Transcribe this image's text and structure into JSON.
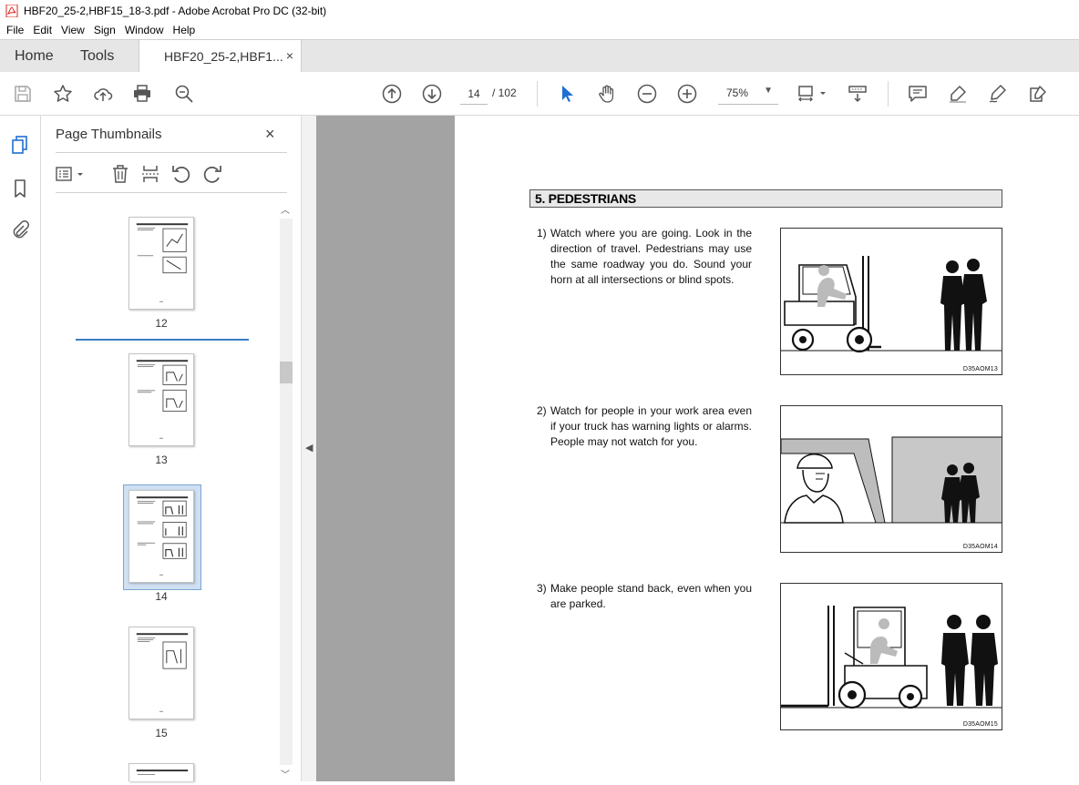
{
  "window": {
    "title": "HBF20_25-2,HBF15_18-3.pdf - Adobe Acrobat Pro DC (32-bit)"
  },
  "menu": [
    "File",
    "Edit",
    "View",
    "Sign",
    "Window",
    "Help"
  ],
  "tabs": {
    "home": "Home",
    "tools": "Tools",
    "document": "HBF20_25-2,HBF1...",
    "close": "×"
  },
  "toolbar": {
    "current_page": "14",
    "total_pages": "/ 102",
    "zoom": "75%",
    "icons": [
      "save-icon",
      "bookmark-star-icon",
      "upload-icon",
      "print-icon",
      "zoom-search-icon",
      "page-up-icon",
      "page-down-icon",
      "select-cursor-icon",
      "hand-icon",
      "zoom-out-icon",
      "zoom-in-icon",
      "page-fit-icon",
      "scroll-mode-icon",
      "comment-icon",
      "highlight-icon",
      "sign-icon",
      "fill-sign-icon"
    ]
  },
  "thumbnails_panel": {
    "title": "Page Thumbnails",
    "close": "×",
    "pages": [
      {
        "label": "12",
        "selected": false
      },
      {
        "label": "13",
        "selected": false
      },
      {
        "label": "14",
        "selected": true
      },
      {
        "label": "15",
        "selected": false
      }
    ]
  },
  "document": {
    "section_title": "5. PEDESTRIANS",
    "items": [
      {
        "num": "1)",
        "text": "Watch where you are going.  Look in the direction of travel.  Pedestrians may use the same roadway you do.  Sound your horn at all intersections or blind spots.",
        "caption": "D35AOM13"
      },
      {
        "num": "2)",
        "text": "Watch for people in your work area even if your truck has warning lights or alarms. People may not watch for you.",
        "caption": "D35AOM14"
      },
      {
        "num": "3)",
        "text": "Make people stand back, even when you are parked.",
        "caption": "D35AOM15"
      }
    ]
  },
  "colors": {
    "active_thumb": "#cfe0f2",
    "accent": "#3b7dc4",
    "prev_page_gray": "#a3a3a3",
    "acrobat_red": "#d7261d"
  }
}
